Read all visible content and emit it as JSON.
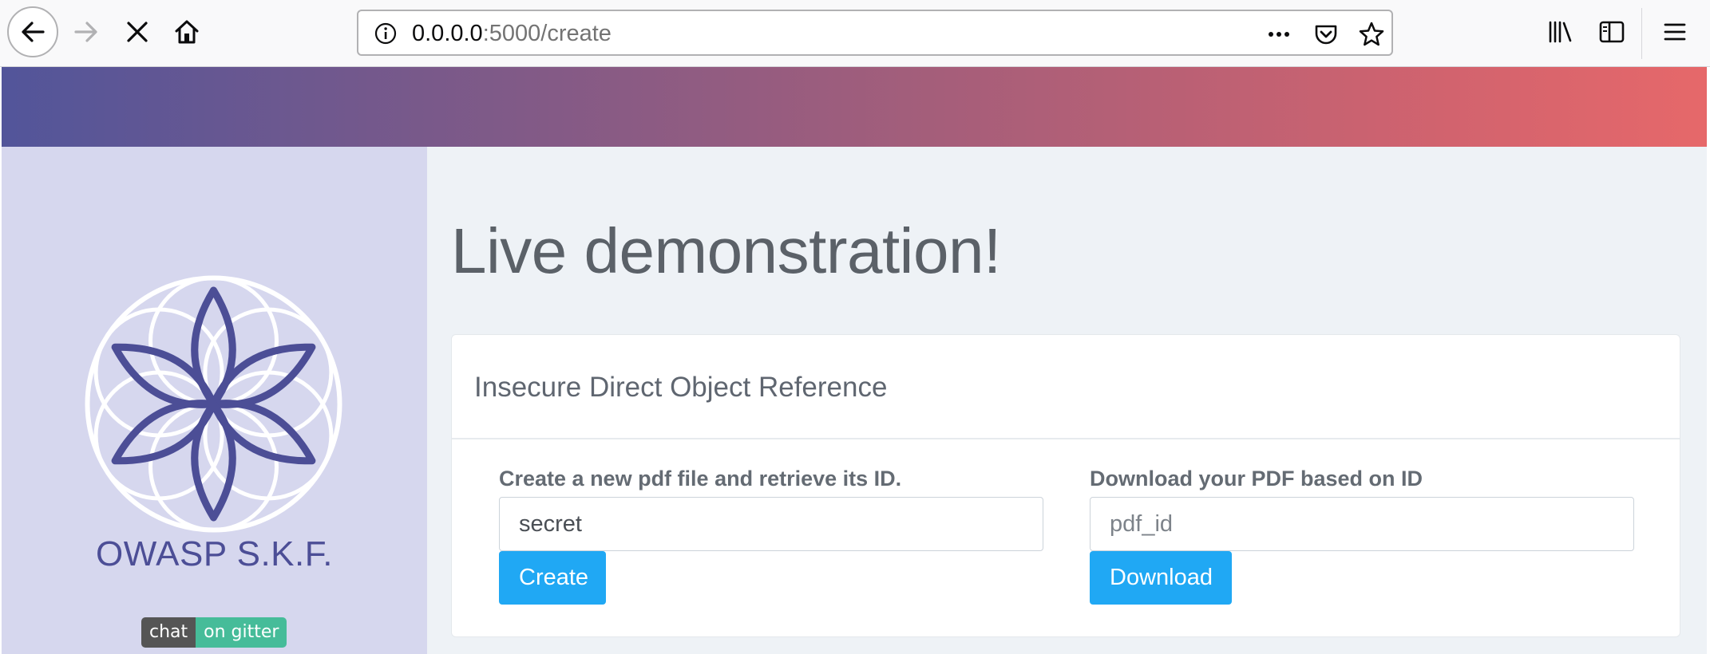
{
  "browser": {
    "url_host": "0.0.0.0",
    "url_path": ":5000/create",
    "icons": [
      "back-icon",
      "forward-icon",
      "stop-icon",
      "home-icon",
      "info-icon",
      "more-icon",
      "pocket-icon",
      "star-icon",
      "library-icon",
      "sidebar-icon",
      "menu-icon"
    ]
  },
  "sidebar": {
    "brand": "OWASP S.K.F.",
    "gitter_left": "chat",
    "gitter_right": "on gitter",
    "logo_color": "#4c4e96"
  },
  "main": {
    "title": "Live demonstration!",
    "card_title": "Insecure Direct Object Reference",
    "create": {
      "label": "Create a new pdf file and retrieve its ID.",
      "value": "secret",
      "button": "Create"
    },
    "download": {
      "label": "Download your PDF based on ID",
      "placeholder": "pdf_id",
      "button": "Download"
    }
  },
  "colors": {
    "accent": "#20a8f4",
    "banner_start": "#52559a",
    "banner_end": "#e6686a",
    "sidebar_bg": "#d6d7ee",
    "gitter_green": "#46bc99"
  }
}
